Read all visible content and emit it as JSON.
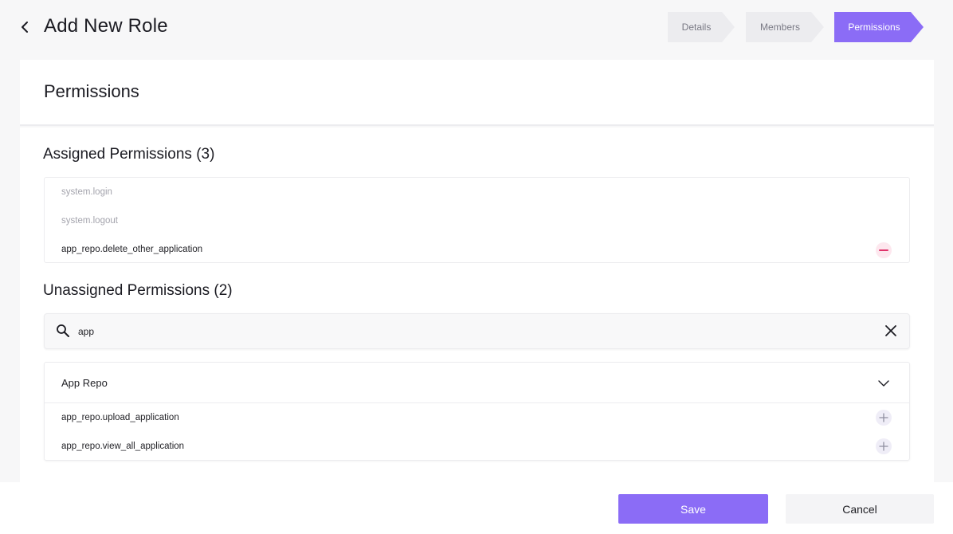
{
  "header": {
    "title": "Add New Role",
    "back_icon": "chevron-left-icon"
  },
  "stepper": {
    "steps": [
      {
        "label": "Details",
        "active": false
      },
      {
        "label": "Members",
        "active": false
      },
      {
        "label": "Permissions",
        "active": true
      }
    ]
  },
  "panel": {
    "title": "Permissions"
  },
  "assigned": {
    "title": "Assigned Permissions (3)",
    "items": [
      {
        "name": "system.login",
        "removable": false
      },
      {
        "name": "system.logout",
        "removable": false
      },
      {
        "name": "app_repo.delete_other_application",
        "removable": true
      }
    ]
  },
  "unassigned": {
    "title": "Unassigned Permissions (2)",
    "search": {
      "value": "app",
      "icon": "search-icon",
      "clear_icon": "close-icon"
    },
    "groups": [
      {
        "name": "App Repo",
        "expanded": true,
        "items": [
          {
            "name": "app_repo.upload_application"
          },
          {
            "name": "app_repo.view_all_application"
          }
        ]
      }
    ]
  },
  "footer": {
    "save_label": "Save",
    "cancel_label": "Cancel"
  },
  "colors": {
    "accent": "#8b6cf6",
    "remove": "#e0336b"
  }
}
